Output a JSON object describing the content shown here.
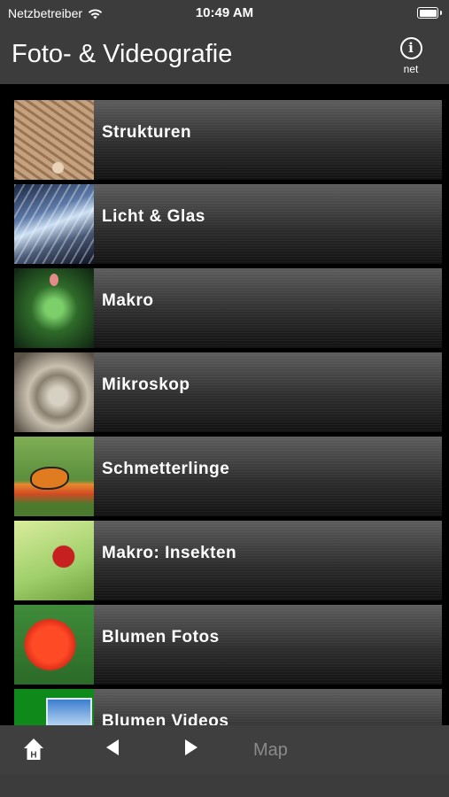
{
  "status": {
    "carrier": "Netzbetreiber",
    "time": "10:49 AM"
  },
  "nav": {
    "title": "Foto- & Videografie",
    "info_label": "net"
  },
  "list": [
    {
      "label": "Strukturen",
      "thumb": "texture-thumbnail"
    },
    {
      "label": "Licht & Glas",
      "thumb": "glass-thumbnail"
    },
    {
      "label": "Makro",
      "thumb": "plant-macro-thumbnail"
    },
    {
      "label": "Mikroskop",
      "thumb": "microscope-thumbnail"
    },
    {
      "label": "Schmetterlinge",
      "thumb": "butterfly-thumbnail"
    },
    {
      "label": "Makro: Insekten",
      "thumb": "ladybug-thumbnail"
    },
    {
      "label": "Blumen Fotos",
      "thumb": "flower-thumbnail"
    },
    {
      "label": "Blumen Videos",
      "thumb": "video-thumbnail"
    }
  ],
  "toolbar": {
    "home_icon": "home-icon",
    "back_icon": "back-arrow-icon",
    "forward_icon": "forward-arrow-icon",
    "map_label": "Map"
  },
  "colors": {
    "bar_bg": "#3c3c3c",
    "background": "#000000",
    "disabled_text": "#8a8a8a"
  }
}
